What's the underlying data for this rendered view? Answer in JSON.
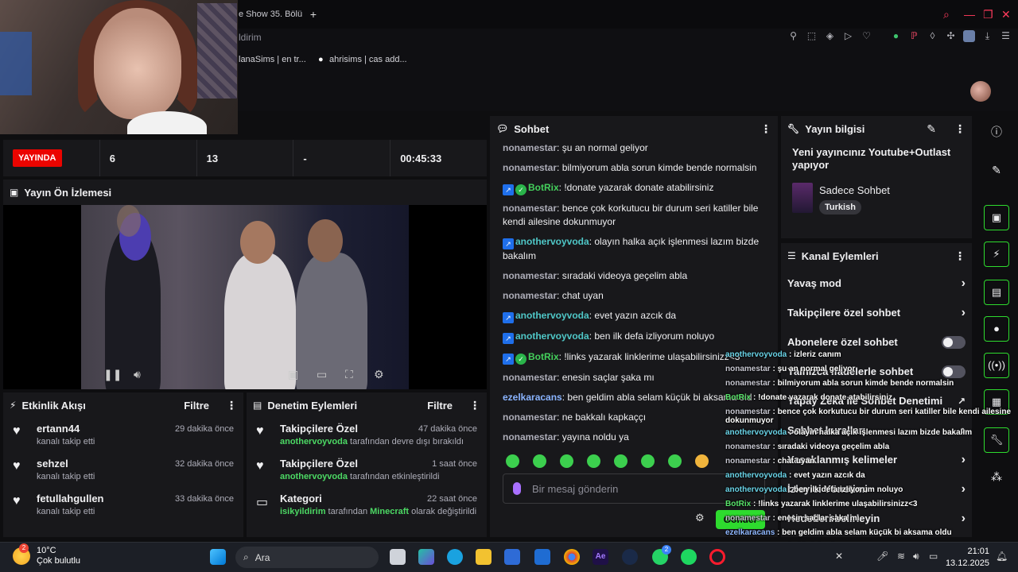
{
  "browser": {
    "tab_label": "e Show 35. Bölü",
    "address_fragment": "ldirim",
    "bookmarks": [
      "lanaSims | en tr...",
      "ahrisims | cas add..."
    ]
  },
  "stats": {
    "live_label": "YAYINDA",
    "viewers": "6",
    "followers": "13",
    "subs": "-",
    "uptime": "00:45:33"
  },
  "preview": {
    "title": "Yayın Ön İzlemesi"
  },
  "activity": {
    "title": "Etkinlik Akışı",
    "filter": "Filtre",
    "items": [
      {
        "name": "ertann44",
        "sub": "kanalı takip etti",
        "time": "29 dakika önce"
      },
      {
        "name": "sehzel",
        "sub": "kanalı takip etti",
        "time": "32 dakika önce"
      },
      {
        "name": "fetullahgullen",
        "sub": "kanalı takip etti",
        "time": "33 dakika önce"
      }
    ]
  },
  "moderation": {
    "title": "Denetim Eylemleri",
    "filter": "Filtre",
    "items": [
      {
        "name": "Takipçilere Özel",
        "actor": "anothervoyvoda",
        "rest": " tarafından devre dışı bırakıldı",
        "time": "47 dakika önce"
      },
      {
        "name": "Takipçilere Özel",
        "actor": "anothervoyvoda",
        "rest": " tarafından etkinleştirildi",
        "time": "1 saat önce"
      },
      {
        "name": "Kategori",
        "actor": "isikyildirim",
        "mid": " tarafından ",
        "category": "Minecraft",
        "rest": " olarak değiştirildi",
        "time": "22 saat önce"
      }
    ]
  },
  "chat": {
    "title": "Sohbet",
    "messages": [
      {
        "user": "nonamestar",
        "text": "şu an normal geliyor"
      },
      {
        "user": "nonamestar",
        "text": "bilmiyorum abla sorun kimde bende normalsin"
      },
      {
        "user": "BotRix",
        "text": "!donate yazarak donate atabilirsiniz"
      },
      {
        "user": "nonamestar",
        "text": "bence çok korkutucu bir durum seri katiller bile kendi ailesine dokunmuyor"
      },
      {
        "user": "anothervoyvoda",
        "text": "olayın halka açık işlenmesi lazım bizde bakalım"
      },
      {
        "user": "nonamestar",
        "text": "sıradaki videoya geçelim abla"
      },
      {
        "user": "nonamestar",
        "text": "chat uyan"
      },
      {
        "user": "anothervoyvoda",
        "text": "evet yazın azcık da"
      },
      {
        "user": "anothervoyvoda",
        "text": "ben ilk defa izliyorum noluyo"
      },
      {
        "user": "BotRix",
        "text": "!links yazarak linklerime ulaşabilirsinizz<3"
      },
      {
        "user": "nonamestar",
        "text": "enesin saçlar şaka mı"
      },
      {
        "user": "ezelkaracans",
        "text": "ben geldim abla selam küçük bi aksama old"
      },
      {
        "user": "nonamestar",
        "text": "ne bakkalı kapkaççı"
      },
      {
        "user": "nonamestar",
        "text": "yayına noldu ya"
      }
    ],
    "input_placeholder": "Bir mesaj gönderin",
    "send_label": "Gönder"
  },
  "stream_info": {
    "title": "Yayın bilgisi",
    "stream_title": "Yeni yayıncınız Youtube+Outlast yapıyor",
    "category": "Sadece Sohbet",
    "language_tag": "Turkish"
  },
  "channel_actions": {
    "title": "Kanal Eylemleri",
    "rows": [
      {
        "label": "Yavaş mod",
        "kind": "chevron"
      },
      {
        "label": "Takipçilere özel sohbet",
        "kind": "chevron"
      },
      {
        "label": "Abonelere özel sohbet",
        "kind": "toggle"
      },
      {
        "label": "Yalnızca ifadelerle sohbet",
        "kind": "toggle"
      },
      {
        "label": "Yapay Zeka ile Sohbet Denetimi",
        "kind": "external"
      },
      {
        "label": "Sohbet kuralları",
        "kind": "chevron"
      },
      {
        "label": "Yasaklanmış kelimeler",
        "kind": "chevron"
      },
      {
        "label": "İzleyici Yönetimi",
        "kind": "chevron"
      },
      {
        "label": "Hedefleri belirleyin",
        "kind": "chevron"
      }
    ]
  },
  "overlay": [
    {
      "user": "anothervoyvoda",
      "text": " : izleriz canım"
    },
    {
      "user": "nonamestar",
      "text": " : şu an normal geliyor"
    },
    {
      "user": "nonamestar",
      "text": " : bilmiyorum abla sorun kimde bende normalsin"
    },
    {
      "user": "BotRix",
      "text": " : !donate yazarak donate atabilirsiniz"
    },
    {
      "user": "nonamestar",
      "text": " : bence çok korkutucu bir durum seri katiller bile kendi ailesine"
    },
    {
      "user": "",
      "text": "dokunmuyor"
    },
    {
      "user": "anothervoyvoda",
      "text": " : olayın halka açık işlenmesi lazım bizde bakalım"
    },
    {
      "user": "nonamestar",
      "text": " : sıradaki videoya geçelim abla"
    },
    {
      "user": "nonamestar",
      "text": " : chat uyan"
    },
    {
      "user": "anothervoyvoda",
      "text": " : evet yazın azcık da"
    },
    {
      "user": "anothervoyvoda",
      "text": " : ben ilk defa izliyorum noluyo"
    },
    {
      "user": "BotRix",
      "text": " : !links yazarak linklerime ulaşabilirsinizz<3"
    },
    {
      "user": "nonamestar",
      "text": " : enesin saçlar şaka mı"
    },
    {
      "user": "ezelkaracans",
      "text": " : ben geldim abla selam küçük bi aksama oldu"
    },
    {
      "user": "nonamestar",
      "text": " : ne bakkalı kapkaççı"
    },
    {
      "user": "nonamestar",
      "text": " : yayına noldu ya"
    }
  ],
  "taskbar": {
    "weather_badge": "2",
    "temp": "10°C",
    "condition": "Çok bulutlu",
    "search": "Ara",
    "whatsapp_badge": "2",
    "time": "21:01",
    "date": "13.12.2025"
  }
}
